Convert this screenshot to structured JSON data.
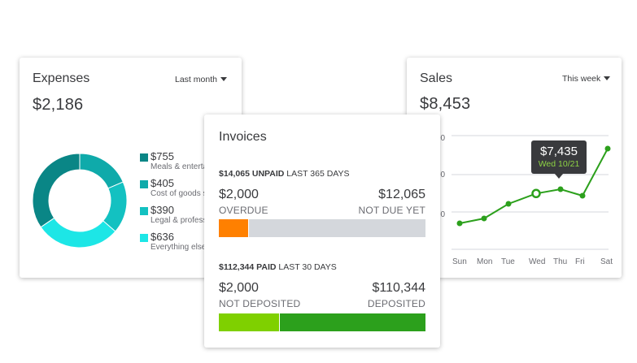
{
  "expenses": {
    "title": "Expenses",
    "range": "Last month",
    "total": "$2,186",
    "items": [
      {
        "amount": "$755",
        "label": "Meals & entertainment",
        "color": "#0a8686"
      },
      {
        "amount": "$405",
        "label": "Cost of goods sold",
        "color": "#0faaaa"
      },
      {
        "amount": "$390",
        "label": "Legal & professional fees",
        "color": "#13c1c1"
      },
      {
        "amount": "$636",
        "label": "Everything else",
        "color": "#1de6e6"
      }
    ]
  },
  "sales": {
    "title": "Sales",
    "range": "This week",
    "total": "$8,453",
    "y_ticks": [
      "00",
      "00",
      "00"
    ],
    "tooltip": {
      "amount": "$7,435",
      "date": "Wed 10/21"
    },
    "line_color": "#2ca01c"
  },
  "chart_data": {
    "type": "line",
    "categories": [
      "Sun",
      "Mon",
      "Tue",
      "Wed",
      "Thu",
      "Fri",
      "Sat"
    ],
    "series": [
      {
        "values": [
          5600,
          5900,
          6800,
          7435,
          7700,
          7300,
          10200
        ]
      }
    ],
    "xlabel": "",
    "ylabel": "",
    "grid": true
  },
  "invoices": {
    "title": "Invoices",
    "unpaid": {
      "summary_amount": "$14,065 UNPAID",
      "summary_period": "LAST 365 DAYS",
      "left_amount": "$2,000",
      "left_label": "OVERDUE",
      "right_amount": "$12,065",
      "right_label": "NOT DUE YET",
      "left_fraction": 0.142,
      "left_color": "#ff8000",
      "right_color": "#d4d7dc"
    },
    "paid": {
      "summary_amount": "$112,344 PAID",
      "summary_period": "LAST 30 DAYS",
      "left_amount": "$2,000",
      "left_label": "NOT DEPOSITED",
      "right_amount": "$110,344",
      "right_label": "DEPOSITED",
      "left_fraction": 0.29,
      "left_color": "#7fd000",
      "right_color": "#2ca01c"
    }
  }
}
